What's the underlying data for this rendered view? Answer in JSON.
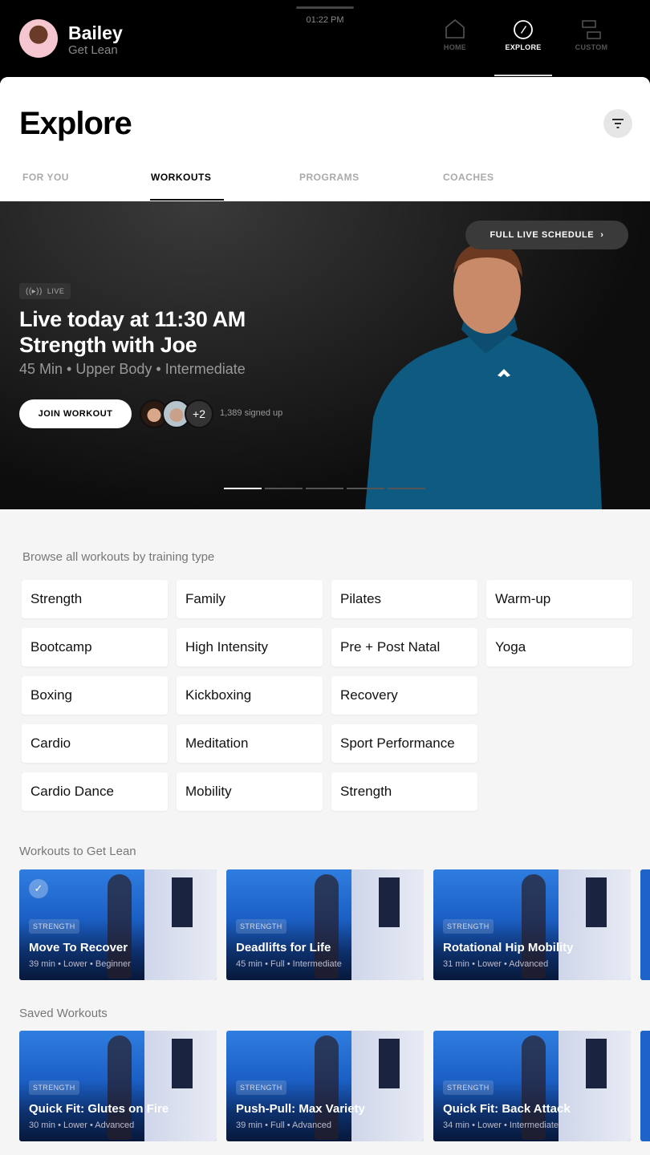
{
  "status": {
    "time": "01:22 PM"
  },
  "user": {
    "name": "Bailey",
    "plan": "Get Lean"
  },
  "nav": [
    {
      "label": "HOME",
      "icon": "home-icon"
    },
    {
      "label": "EXPLORE",
      "icon": "compass-icon",
      "active": true
    },
    {
      "label": "CUSTOM",
      "icon": "custom-layout-icon"
    }
  ],
  "page": {
    "title": "Explore"
  },
  "tabs": [
    {
      "label": "FOR YOU"
    },
    {
      "label": "WORKOUTS",
      "active": true
    },
    {
      "label": "PROGRAMS"
    },
    {
      "label": "COACHES"
    }
  ],
  "hero": {
    "schedule_label": "FULL LIVE SCHEDULE",
    "live_label": "LIVE",
    "title_line1": "Live today at 11:30 AM",
    "title_line2": "Strength with Joe",
    "meta": "45 Min • Upper Body • Intermediate",
    "join_label": "JOIN WORKOUT",
    "more_attendees": "+2",
    "signed_up": "1,389 signed up",
    "carousel_index": 1,
    "carousel_count": 5
  },
  "browse": {
    "heading": "Browse all workouts by training type",
    "types": [
      "Strength",
      "Bootcamp",
      "Boxing",
      "Cardio",
      "Cardio Dance",
      "Family",
      "High Intensity",
      "Kickboxing",
      "Meditation",
      "Mobility",
      "Pilates",
      "Pre + Post Natal",
      "Recovery",
      "Sport Performance",
      "Strength",
      "Warm-up",
      "Yoga"
    ]
  },
  "get_lean": {
    "heading": "Workouts to Get Lean",
    "cards": [
      {
        "tag": "STRENGTH",
        "title": "Move To Recover",
        "meta": "39 min • Lower • Beginner",
        "completed": true
      },
      {
        "tag": "STRENGTH",
        "title": "Deadlifts for Life",
        "meta": "45 min • Full • Intermediate"
      },
      {
        "tag": "STRENGTH",
        "title": "Rotational Hip Mobility",
        "meta": "31 min • Lower • Advanced"
      }
    ]
  },
  "saved": {
    "heading": "Saved Workouts",
    "cards": [
      {
        "tag": "STRENGTH",
        "title": "Quick Fit: Glutes on Fire",
        "meta": "30 min • Lower • Advanced"
      },
      {
        "tag": "STRENGTH",
        "title": "Push-Pull: Max Variety",
        "meta": "39 min • Full • Advanced"
      },
      {
        "tag": "STRENGTH",
        "title": "Quick Fit: Back Attack",
        "meta": "34 min • Lower • Intermediate"
      }
    ]
  }
}
